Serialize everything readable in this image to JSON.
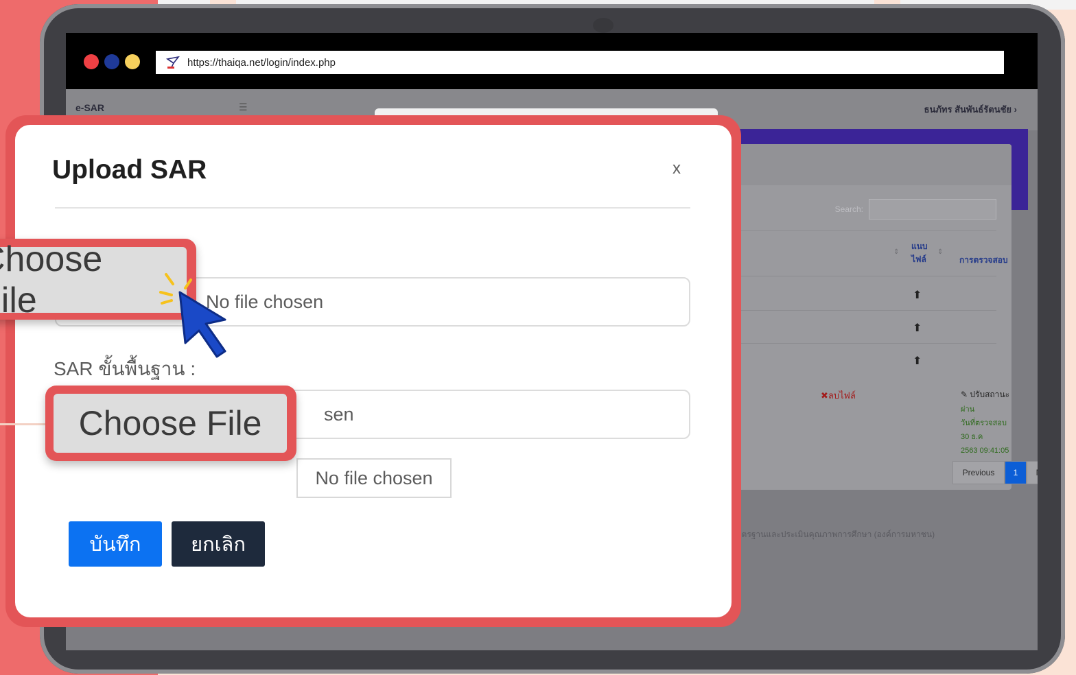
{
  "browser": {
    "url": "https://thaiqa.net/login/index.php",
    "traffic_lights": [
      "#ef4044",
      "#1f3a99",
      "#f6d05d"
    ]
  },
  "app": {
    "brand": "e-SAR",
    "menu_icon": "hamburger-icon",
    "user_name": "ธนภัทร สันพันธ์รัตนชัย ›",
    "table": {
      "search_label": "Search:",
      "columns": [
        "แนบ ไฟล์",
        "การตรวจสอบ"
      ],
      "delete_link": "✖ลบไฟล์",
      "status_label": "ปรับสถานะ",
      "status_detail": [
        "ผ่าน",
        "วันที่ตรวจสอบ 30 ธ.ค",
        "2563 09:41:05"
      ],
      "pager": [
        "Previous",
        "1",
        "Next"
      ]
    },
    "footer": "สำนักงานรับรองมาตรฐานและประเมินคุณภาพการศึกษา (องค์การมหาชน)"
  },
  "modal": {
    "title": "Upload SAR",
    "close": "x",
    "file_input_1_status": "No file chosen",
    "sar_label": "SAR ขั้นพื้นฐาน :",
    "file_input_2_status": "sen",
    "no_file_chosen": "No file chosen",
    "save_label": "บันทึก",
    "cancel_label": "ยกเลิก"
  },
  "callouts": {
    "choose_file_1": "Choose File",
    "choose_file_2": "Choose File"
  },
  "colors": {
    "accent_red": "#e35557",
    "save_blue": "#0c72f2",
    "cancel_navy": "#1e2a3c",
    "purple_header": "#3b2497"
  }
}
